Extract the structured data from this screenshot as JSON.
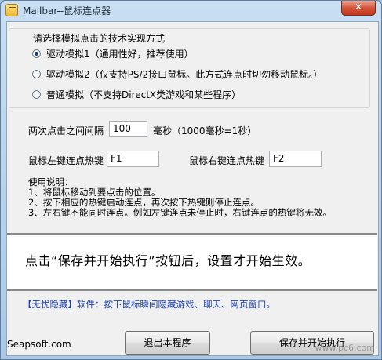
{
  "window": {
    "title": "Mailbar--鼠标连点器",
    "close_symbol": "✕"
  },
  "technique_group": {
    "title": "请选择模拟点击的技术实现方式",
    "options": [
      {
        "label": "驱动模拟1（通用性好，推荐使用）",
        "selected": true
      },
      {
        "label": "驱动模拟2（仅支持PS/2接口鼠标。此方式连点时切勿移动鼠标。）",
        "selected": false
      },
      {
        "label": "普通模拟（不支持DirectX类游戏和某些程序）",
        "selected": false
      }
    ]
  },
  "interval": {
    "label": "两次点击之间间隔",
    "value": "100",
    "unit": "毫秒（1000毫秒=1秒）"
  },
  "hotkeys": {
    "left_label": "鼠标左键连点热键",
    "left_value": "F1",
    "right_label": "鼠标右键连点热键",
    "right_value": "F2"
  },
  "instructions": [
    "使用说明：",
    "1、将鼠标移动到要点击的位置。",
    "2、按下相应的热键启动连点，再次按下热键则停止连点。",
    "3、左右键不能同时连点。例如左键连点未停止时，右键连点的热键将无效。"
  ],
  "notice": "点击“保存并开始执行”按钮后，设置才开始生效。",
  "promo": "【无忧隐藏】软件：按下鼠标瞬间隐藏游戏、聊天、网页窗口。",
  "footer": {
    "site": "Seapsoft.com",
    "exit_button": "退出本程序",
    "save_button": "保存并开始执行",
    "watermark": "www.pc6.com"
  }
}
